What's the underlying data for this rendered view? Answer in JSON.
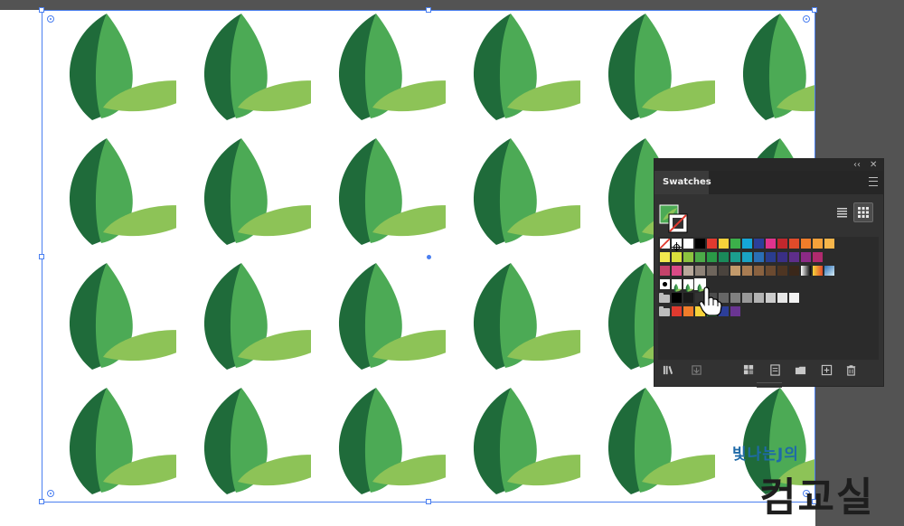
{
  "panel": {
    "tab_label": "Swatches",
    "collapse_glyph": "‹‹",
    "close_glyph": "✕"
  },
  "colors": {
    "pasteboard": "#535353",
    "selection": "#4a7ff0",
    "leaf_dark": "#1f6b3a",
    "leaf_mid": "#4caa55",
    "leaf_light": "#8dc357",
    "panel_bg": "#323232"
  },
  "watermark": {
    "small_text": "빛나는J의",
    "large_text": "컴교실"
  },
  "icons": {
    "library": "swatch-libraries-icon",
    "place": "place-swatches-icon",
    "show_kinds": "show-swatch-kinds-icon",
    "options": "swatch-options-icon",
    "folder": "new-color-group-icon",
    "new": "new-swatch-icon",
    "delete": "delete-swatch-icon"
  },
  "swatch_rows": [
    [
      "none",
      "registration",
      "#ffffff",
      "#000000",
      "#e03a2f",
      "#f6d23a",
      "#3cb04a",
      "#15a7d8",
      "#2c3e99",
      "#e0338e",
      "#c1272d",
      "#e04b2a",
      "#f07d2a",
      "#f5a13a",
      "#f7b54a"
    ],
    [
      "#f2e94e",
      "#d9df3c",
      "#8dc33f",
      "#4caa48",
      "#2a9a47",
      "#1a8a5a",
      "#1b9e8e",
      "#1aa3c4",
      "#2a6fb6",
      "#2a3d8f",
      "#3a2f85",
      "#5e2e8a",
      "#8c2a86",
      "#b02a6e"
    ],
    [
      "#c4426a",
      "#d94a86",
      "#b8a89a",
      "#8f8378",
      "#6e655c",
      "#4a433d",
      "#c29a6b",
      "#a87c52",
      "#8a6240",
      "#6b4a30",
      "#4e3522",
      "#3a271a",
      "grad-bw",
      "grad-orange",
      "grad-blue"
    ],
    [
      "pattern-dots",
      "pattern-leaf1",
      "pattern-leaf2",
      "pattern-leaf3"
    ],
    [
      "folder",
      "#000000",
      "#1a1a1a",
      "#333333",
      "#4d4d4d",
      "#666666",
      "#808080",
      "#999999",
      "#b3b3b3",
      "#cccccc",
      "#e6e6e6",
      "#f2f2f2"
    ],
    [
      "folder",
      "#e03a2f",
      "#f07d2a",
      "#f6d23a",
      "#3cb04a",
      "#2c3e99",
      "#6a3592"
    ]
  ]
}
